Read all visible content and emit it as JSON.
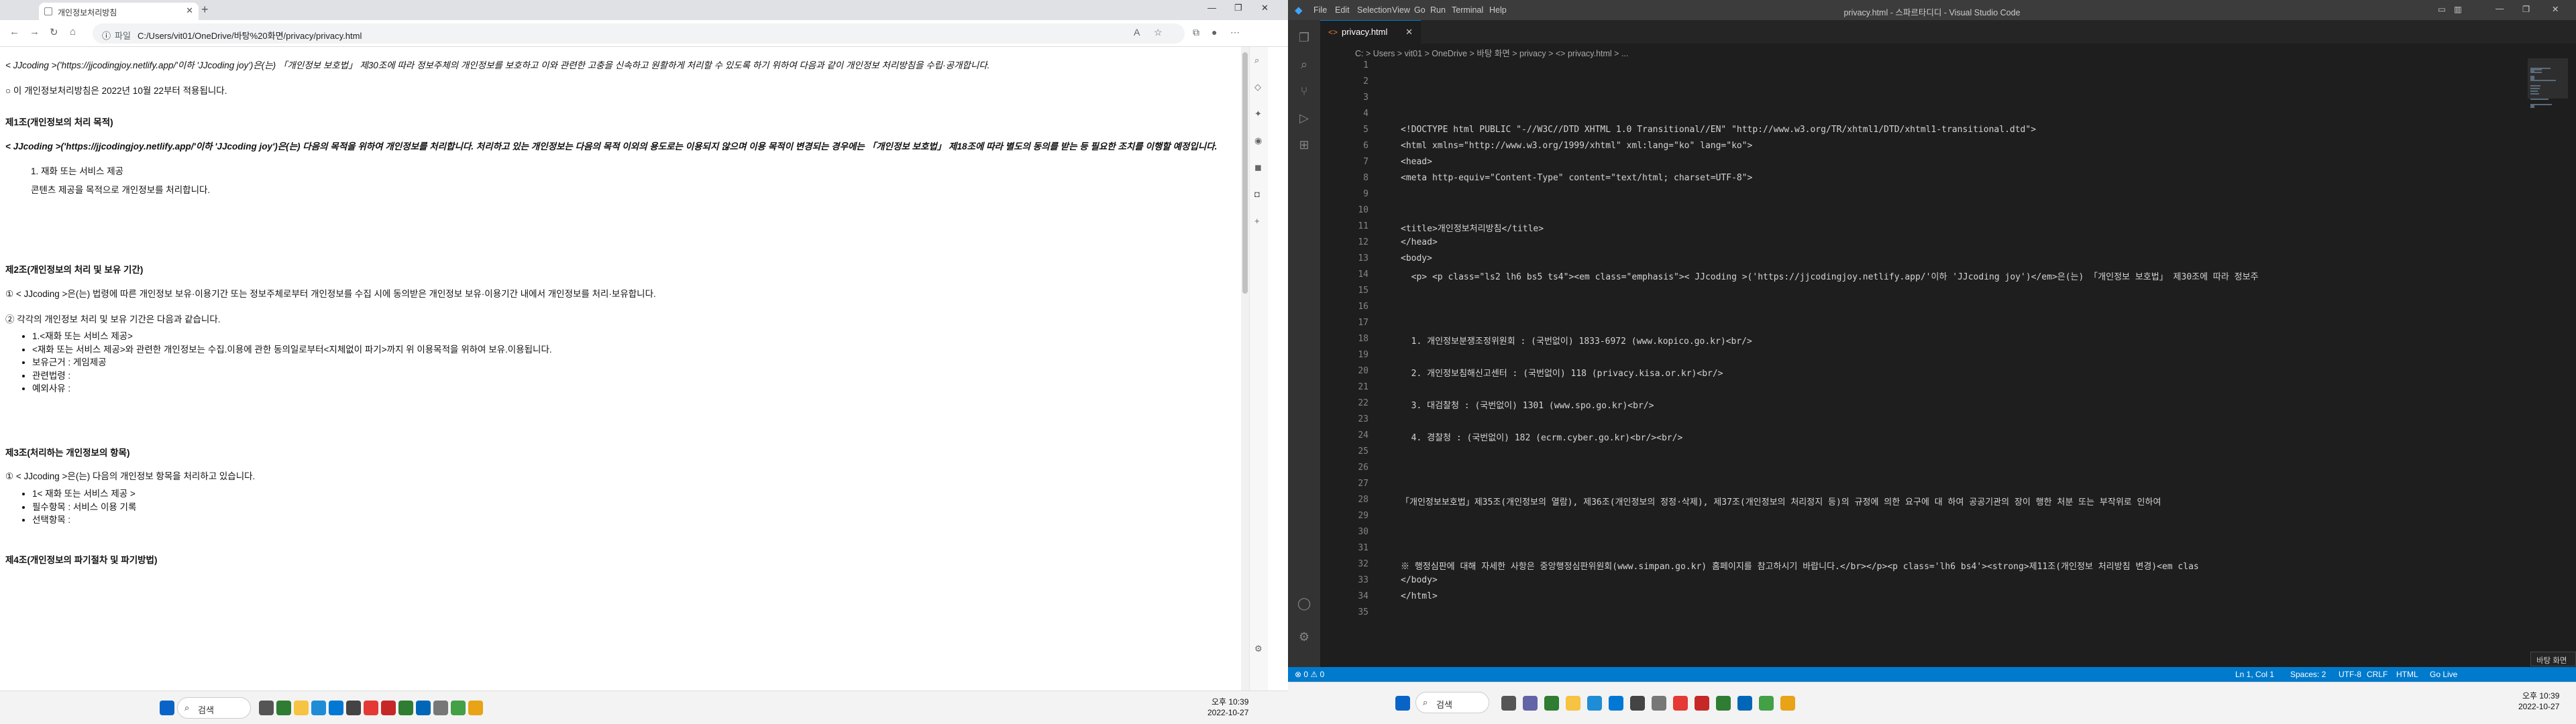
{
  "browser": {
    "tab_title": "개인정보처리방침",
    "address_label": "파일",
    "address": "C:/Users/vit01/OneDrive/바탕%20화면/privacy/privacy.html"
  },
  "page": {
    "intro": "< JJcoding >('https://jjcodingjoy.netlify.app/'이하 'JJcoding joy')은(는) 「개인정보 보호법」 제30조에 따라 정보주체의 개인정보를 보호하고 이와 관련한 고충을 신속하고 원활하게 처리할 수 있도록 하기 위하여 다음과 같이 개인정보 처리방침을 수립·공개합니다.",
    "effective": "○ 이 개인정보처리방침은 2022년 10월 22부터 적용됩니다.",
    "s1_title": "제1조(개인정보의 처리 목적)",
    "s1_body": "< JJcoding >('https://jjcodingjoy.netlify.app/'이하 'JJcoding joy')은(는) 다음의 목적을 위하여 개인정보를 처리합니다. 처리하고 있는 개인정보는 다음의 목적 이외의 용도로는 이용되지 않으며 이용 목적이 변경되는 경우에는 「개인정보 보호법」 제18조에 따라 별도의 동의를 받는 등 필요한 조치를 이행할 예정입니다.",
    "s1_item": "1. 재화 또는 서비스 제공",
    "s1_item_desc": "콘텐츠 제공을 목적으로 개인정보를 처리합니다.",
    "s2_title": "제2조(개인정보의 처리 및 보유 기간)",
    "s2_p1": "① < JJcoding >은(는) 법령에 따른 개인정보 보유·이용기간 또는 정보주체로부터 개인정보를 수집 시에 동의받은 개인정보 보유·이용기간 내에서 개인정보를 처리·보유합니다.",
    "s2_p2": "② 각각의 개인정보 처리 및 보유 기간은 다음과 같습니다.",
    "s2_list": [
      "1.<재화 또는 서비스 제공>",
      "<재화 또는 서비스 제공>와 관련한 개인정보는 수집.이용에 관한 동의일로부터<지체없이 파기>까지 위 이용목적을 위하여 보유.이용됩니다.",
      "보유근거 : 게임제공",
      "관련법령 :",
      "예외사유 :"
    ],
    "s3_title": "제3조(처리하는 개인정보의 항목)",
    "s3_p1": "① < JJcoding >은(는) 다음의 개인정보 항목을 처리하고 있습니다.",
    "s3_list": [
      "1< 재화 또는 서비스 제공 >",
      "필수항목 : 서비스 이용 기록",
      "선택항목 :"
    ],
    "s4_title": "제4조(개인정보의 파기절차 및 파기방법)"
  },
  "taskbar_left": {
    "search": "검색",
    "time": "오후 10:39",
    "date": "2022-10-27"
  },
  "vscode": {
    "menu": [
      "File",
      "Edit",
      "Selection",
      "View",
      "Go",
      "Run",
      "Terminal",
      "Help"
    ],
    "title": "privacy.html - 스파르타디디 - Visual Studio Code",
    "tab": "privacy.html",
    "breadcrumb": "C: > Users > vit01 > OneDrive > 바탕 화면 > privacy > <> privacy.html > ...",
    "lines": [
      {
        "n": "1",
        "t": ""
      },
      {
        "n": "2",
        "t": ""
      },
      {
        "n": "3",
        "t": ""
      },
      {
        "n": "4",
        "t": ""
      },
      {
        "n": "5",
        "t": "<!DOCTYPE html PUBLIC \"-//W3C//DTD XHTML 1.0 Transitional//EN\" \"http://www.w3.org/TR/xhtml1/DTD/xhtml1-transitional.dtd\">"
      },
      {
        "n": "6",
        "t": "<html xmlns=\"http://www.w3.org/1999/xhtml\" xml:lang=\"ko\" lang=\"ko\">"
      },
      {
        "n": "7",
        "t": "<head>"
      },
      {
        "n": "8",
        "t": "<meta http-equiv=\"Content-Type\" content=\"text/html; charset=UTF-8\">"
      },
      {
        "n": "9",
        "t": ""
      },
      {
        "n": "10",
        "t": ""
      },
      {
        "n": "11",
        "t": "<title>개인정보처리방침</title>"
      },
      {
        "n": "12",
        "t": "</head>"
      },
      {
        "n": "13",
        "t": "<body>"
      },
      {
        "n": "14",
        "t": "  <p> <p class=\"ls2 lh6 bs5 ts4\"><em class=\"emphasis\">< JJcoding >('https://jjcodingjoy.netlify.app/'이하 'JJcoding joy')</em>은(는) 「개인정보 보호법」 제30조에 따라 정보주"
      },
      {
        "n": "15",
        "t": ""
      },
      {
        "n": "16",
        "t": ""
      },
      {
        "n": "17",
        "t": ""
      },
      {
        "n": "18",
        "t": "  1. 개인정보분쟁조정위원회 : (국번없이) 1833-6972 (www.kopico.go.kr)<br/>"
      },
      {
        "n": "19",
        "t": ""
      },
      {
        "n": "20",
        "t": "  2. 개인정보침해신고센터 : (국번없이) 118 (privacy.kisa.or.kr)<br/>"
      },
      {
        "n": "21",
        "t": ""
      },
      {
        "n": "22",
        "t": "  3. 대검찰청 : (국번없이) 1301 (www.spo.go.kr)<br/>"
      },
      {
        "n": "23",
        "t": ""
      },
      {
        "n": "24",
        "t": "  4. 경찰청 : (국번없이) 182 (ecrm.cyber.go.kr)<br/><br/>"
      },
      {
        "n": "25",
        "t": ""
      },
      {
        "n": "26",
        "t": ""
      },
      {
        "n": "27",
        "t": ""
      },
      {
        "n": "28",
        "t": "「개인정보보호법」제35조(개인정보의 열람), 제36조(개인정보의 정정·삭제), 제37조(개인정보의 처리정지 등)의 규정에 의한 요구에 대 하여 공공기관의 장이 행한 처분 또는 부작위로 인하여"
      },
      {
        "n": "29",
        "t": ""
      },
      {
        "n": "30",
        "t": ""
      },
      {
        "n": "31",
        "t": ""
      },
      {
        "n": "32",
        "t": "※ 행정심판에 대해 자세한 사항은 중앙행정심판위원회(www.simpan.go.kr) 홈페이지를 참고하시기 바랍니다.</br></p><p class='lh6 bs4'><strong>제11조(개인정보 처리방침 변경)<em clas"
      },
      {
        "n": "33",
        "t": "</body>"
      },
      {
        "n": "34",
        "t": "</html>"
      },
      {
        "n": "35",
        "t": ""
      }
    ],
    "status_left": "⊗ 0 ⚠ 0",
    "status_right": [
      "Ln 1, Col 1",
      "Spaces: 2",
      "UTF-8",
      "CRLF",
      "HTML",
      "Go Live"
    ],
    "toast": "바탕 화면 보기"
  },
  "taskbar_right": {
    "search": "검색",
    "time": "오후 10:39",
    "date": "2022-10-27"
  }
}
